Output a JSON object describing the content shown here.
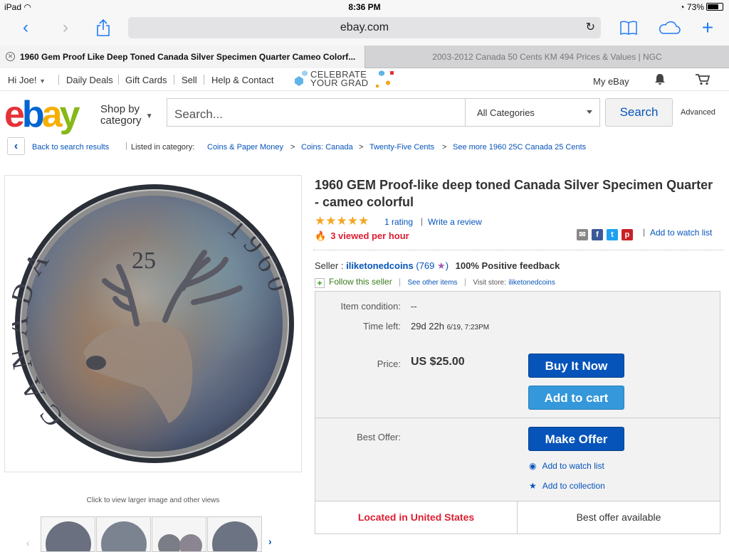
{
  "status_bar": {
    "device": "iPad",
    "time": "8:36 PM",
    "battery": "73%",
    "battery_level": 0.73
  },
  "browser": {
    "url": "ebay.com",
    "tabs": [
      {
        "label": "1960 Gem Proof Like Deep Toned Canada Silver Specimen Quarter Cameo Colorf..."
      },
      {
        "label": "2003-2012 Canada 50 Cents KM 494 Prices & Values | NGC"
      }
    ]
  },
  "topnav": {
    "greeting": "Hi Joe!",
    "items": [
      "Daily Deals",
      "Gift Cards",
      "Sell",
      "Help & Contact"
    ],
    "promo_line1": "CELEBRATE",
    "promo_line2": "YOUR GRAD",
    "my_ebay": "My eBay"
  },
  "header": {
    "logo": [
      "e",
      "b",
      "a",
      "y"
    ],
    "logo_colors": [
      "#e53238",
      "#0064d2",
      "#f5af02",
      "#86b817"
    ],
    "shop_by": "Shop by",
    "category": "category",
    "search_placeholder": "Search...",
    "category_select": "All Categories",
    "search_button": "Search",
    "advanced": "Advanced"
  },
  "breadcrumb": {
    "back": "Back to search results",
    "listed_in": "Listed in category:",
    "path": [
      "Coins & Paper Money",
      "Coins: Canada",
      "Twenty-Five Cents",
      "See more 1960 25C Canada 25 Cents"
    ]
  },
  "product_image": {
    "legend_text": "CANADA",
    "denomination": "25",
    "year_text": "1960",
    "caption": "Click to view larger image and other views"
  },
  "listing": {
    "title": "1960 GEM Proof-like deep toned Canada Silver Specimen Quarter - cameo colorful",
    "stars": "★★★★★",
    "rating": "1 rating",
    "write_review": "Write a review",
    "viewed": "3 viewed per hour",
    "add_to_watch": "Add to watch list",
    "seller_label": "Seller :",
    "seller_name": "iliketonedcoins",
    "seller_score": "769",
    "feedback": "100% Positive feedback",
    "follow": "Follow this seller",
    "see_other": "See other items",
    "visit_store": "Visit store:",
    "store_name": "iliketonedcoins"
  },
  "purchase": {
    "condition_label": "Item condition:",
    "condition_value": "--",
    "time_left_label": "Time left:",
    "time_left_value": "29d 22h",
    "time_left_date": "6/19, 7:23PM",
    "price_label": "Price:",
    "price_value": "US $25.00",
    "buy_now": "Buy It Now",
    "add_to_cart": "Add to cart",
    "best_offer_label": "Best Offer:",
    "make_offer": "Make Offer",
    "add_watch": "Add to watch list",
    "add_collection": "Add to collection",
    "location": "Located in United States",
    "best_offer_available": "Best offer available"
  },
  "colors": {
    "link": "#0654ba",
    "button_blue": "#0654ba",
    "alert_red": "#dd1e31",
    "star": "#f5a623",
    "ios_blue": "#1f7cf5"
  }
}
